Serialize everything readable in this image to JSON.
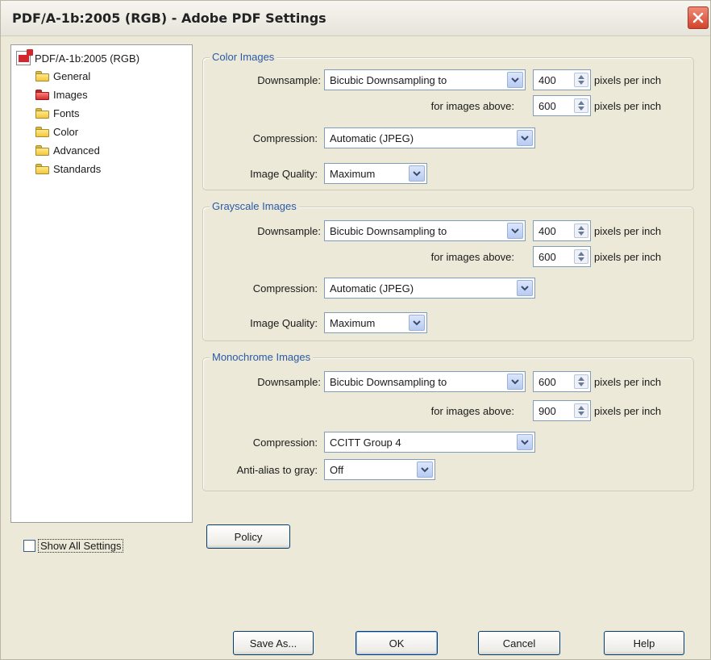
{
  "window": {
    "title": "PDF/A-1b:2005 (RGB) - Adobe PDF Settings"
  },
  "tree": {
    "root_label": "PDF/A-1b:2005 (RGB)",
    "items": [
      {
        "label": "General",
        "icon": "folder-icon"
      },
      {
        "label": "Images",
        "icon": "folder-open-icon"
      },
      {
        "label": "Fonts",
        "icon": "folder-icon"
      },
      {
        "label": "Color",
        "icon": "folder-icon"
      },
      {
        "label": "Advanced",
        "icon": "folder-icon"
      },
      {
        "label": "Standards",
        "icon": "folder-icon"
      }
    ]
  },
  "show_all_settings": {
    "label": "Show All Settings",
    "checked": false
  },
  "color_images": {
    "title": "Color Images",
    "downsample_label": "Downsample:",
    "downsample_value": "Bicubic Downsampling to",
    "ppi_value": "400",
    "ppi_unit": "pixels per inch",
    "above_label": "for images above:",
    "above_value": "600",
    "above_unit": "pixels per inch",
    "compression_label": "Compression:",
    "compression_value": "Automatic (JPEG)",
    "quality_label": "Image Quality:",
    "quality_value": "Maximum"
  },
  "grayscale_images": {
    "title": "Grayscale Images",
    "downsample_label": "Downsample:",
    "downsample_value": "Bicubic Downsampling to",
    "ppi_value": "400",
    "ppi_unit": "pixels per inch",
    "above_label": "for images above:",
    "above_value": "600",
    "above_unit": "pixels per inch",
    "compression_label": "Compression:",
    "compression_value": "Automatic (JPEG)",
    "quality_label": "Image Quality:",
    "quality_value": "Maximum"
  },
  "monochrome_images": {
    "title": "Monochrome Images",
    "downsample_label": "Downsample:",
    "downsample_value": "Bicubic Downsampling to",
    "ppi_value": "600",
    "ppi_unit": "pixels per inch",
    "above_label": "for images above:",
    "above_value": "900",
    "above_unit": "pixels per inch",
    "compression_label": "Compression:",
    "compression_value": "CCITT Group 4",
    "antialias_label": "Anti-alias to gray:",
    "antialias_value": "Off"
  },
  "buttons": {
    "policy": "Policy",
    "save_as": "Save As...",
    "ok": "OK",
    "cancel": "Cancel",
    "help": "Help"
  },
  "colors": {
    "dialog_bg": "#ece9d8",
    "group_title": "#2a5aa8",
    "close_button": "#d2442b"
  }
}
